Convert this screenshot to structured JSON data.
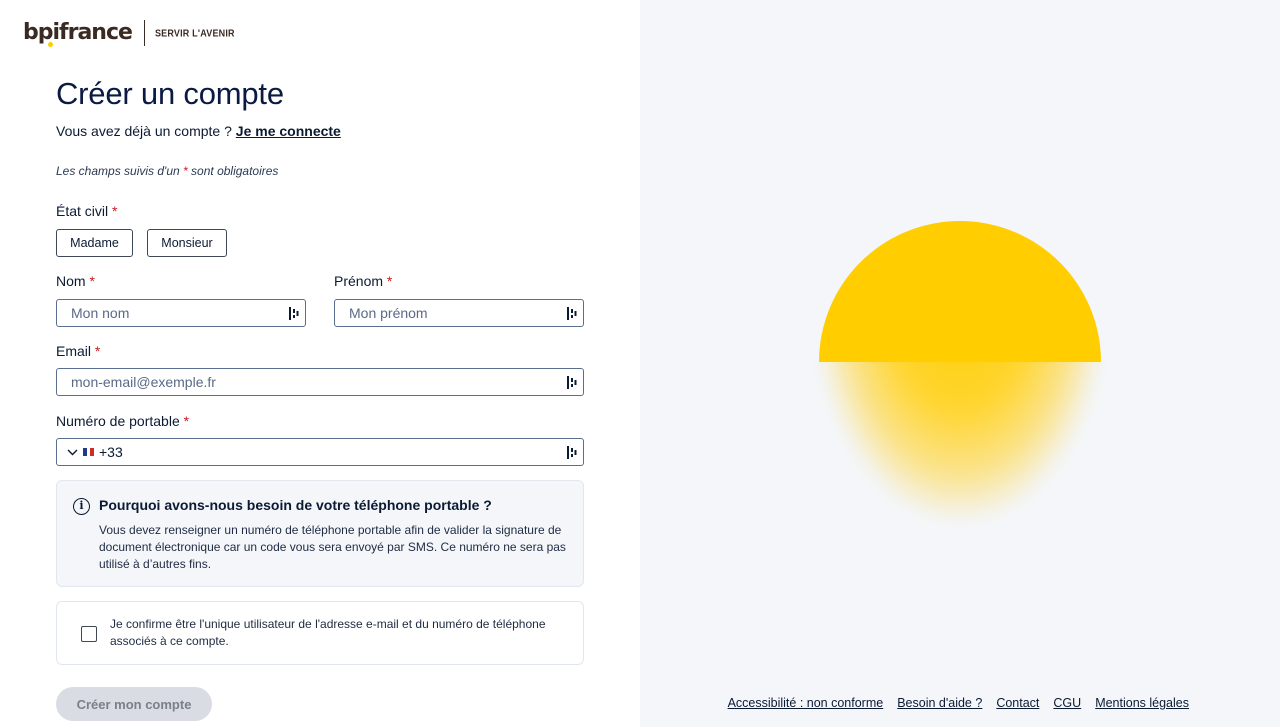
{
  "brand": {
    "logo_text": "bpifrance",
    "tagline": "SERVIR L'AVENIR"
  },
  "page": {
    "title": "Créer un compte",
    "have_account_text": "Vous avez déjà un compte ?",
    "login_link": "Je me connecte",
    "required_note_prefix": "Les champs suivis d'un",
    "required_star": "*",
    "required_note_suffix": "sont obligatoires"
  },
  "form": {
    "civility": {
      "label": "État civil",
      "options": [
        "Madame",
        "Monsieur"
      ]
    },
    "last_name": {
      "label": "Nom",
      "placeholder": "Mon nom",
      "value": ""
    },
    "first_name": {
      "label": "Prénom",
      "placeholder": "Mon prénom",
      "value": ""
    },
    "email": {
      "label": "Email",
      "placeholder": "mon-email@exemple.fr",
      "value": ""
    },
    "phone": {
      "label": "Numéro de portable",
      "dial_code": "+33",
      "country": "France",
      "value": ""
    }
  },
  "info": {
    "icon": "info-icon",
    "title": "Pourquoi avons-nous besoin de votre téléphone portable ?",
    "text": "Vous devez renseigner un numéro de téléphone portable afin de valider la signature de document électronique car un code vous sera envoyé par SMS. Ce numéro ne sera pas utilisé à d’autres fins."
  },
  "confirm": {
    "text": "Je confirme être l'unique utilisateur de l'adresse e-mail et du numéro de téléphone associés à ce compte.",
    "checked": false
  },
  "submit_label": "Créer mon compte",
  "footer": {
    "links": [
      "Accessibilité : non conforme",
      "Besoin d'aide ?",
      "Contact",
      "CGU",
      "Mentions légales"
    ]
  },
  "colors": {
    "accent_yellow": "#ffcd00",
    "required_red": "#c9191e",
    "navy": "#0b1a42",
    "panel_bg": "#f4f6fa"
  }
}
